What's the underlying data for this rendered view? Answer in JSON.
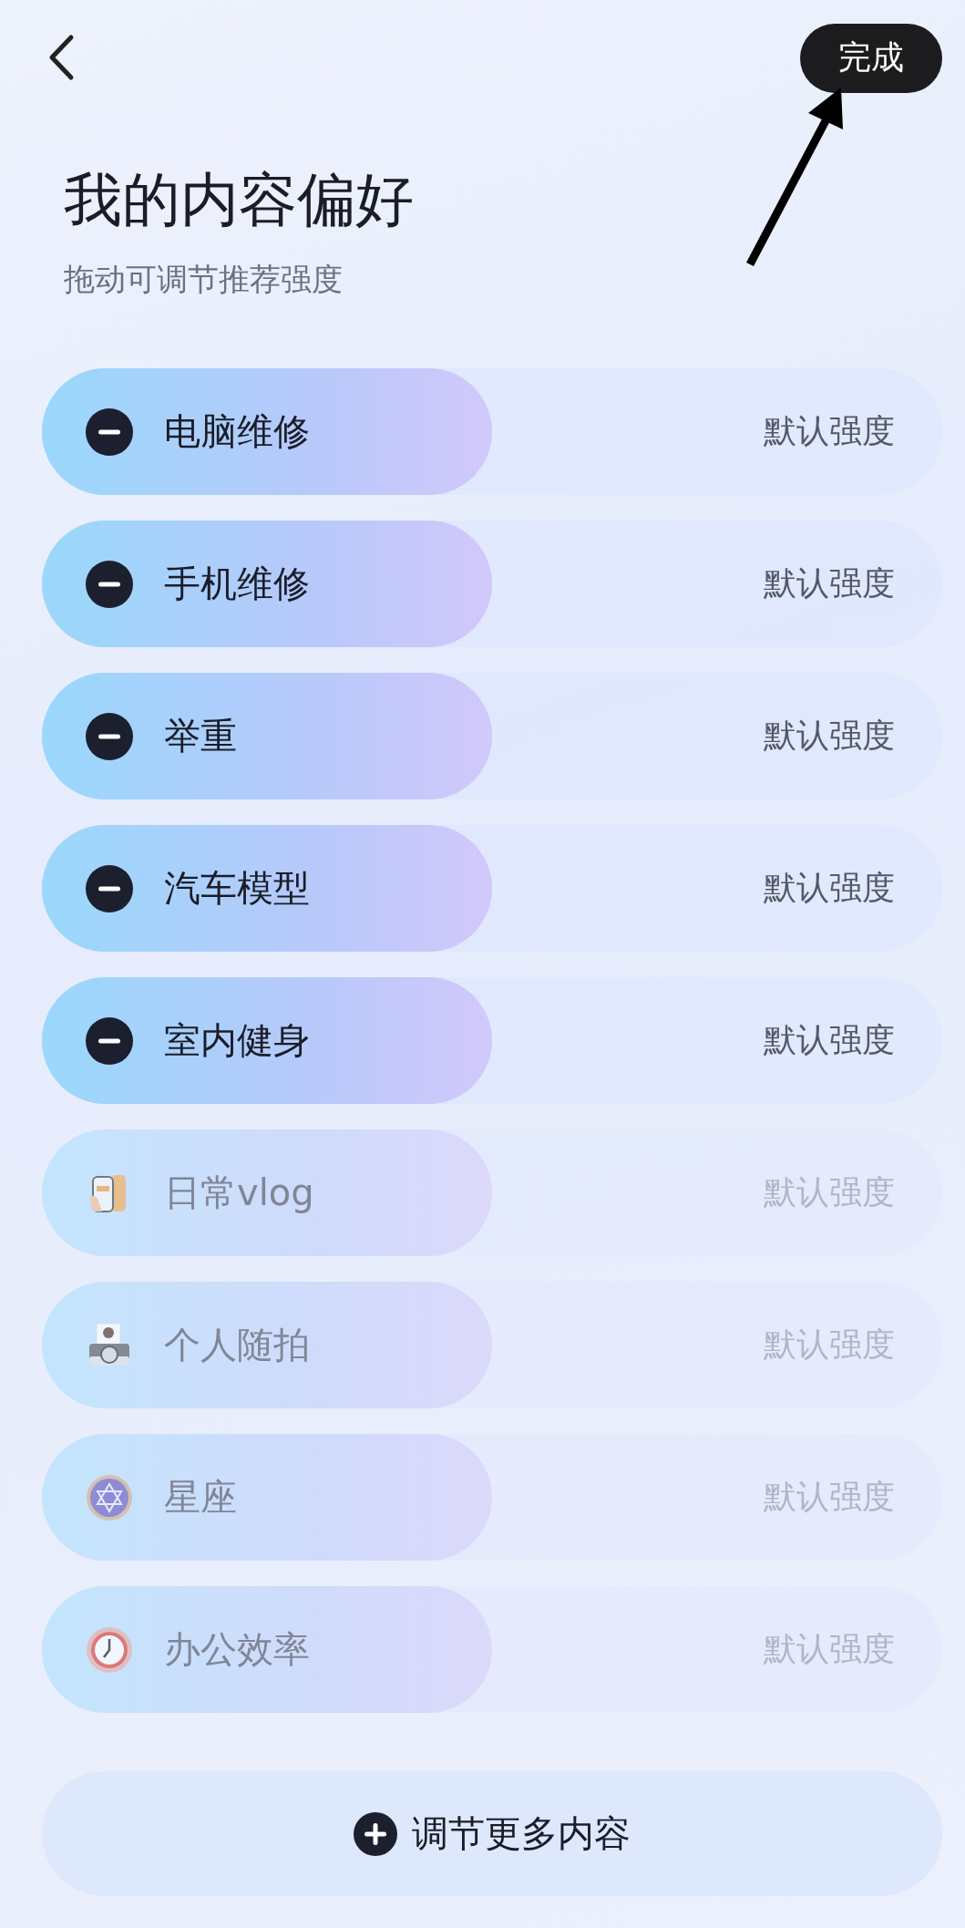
{
  "header": {
    "done_button": "完成"
  },
  "title": "我的内容偏好",
  "subtitle": "拖动可调节推荐强度",
  "rows": [
    {
      "label": "电脑维修",
      "added": true,
      "level": 0.5,
      "reading": "默认强度"
    },
    {
      "label": "手机维修",
      "added": true,
      "level": 0.5,
      "reading": "默认强度"
    },
    {
      "label": "举重",
      "added": true,
      "level": 0.5,
      "reading": "默认强度"
    },
    {
      "label": "汽车模型",
      "added": true,
      "level": 0.5,
      "reading": "默认强度"
    },
    {
      "label": "室内健身",
      "added": true,
      "level": 0.5,
      "reading": "默认强度"
    },
    {
      "label": "日常vlog",
      "added": false,
      "level": 0.5,
      "reading": "默认强度"
    },
    {
      "label": "个人随拍",
      "added": false,
      "level": 0.5,
      "reading": "默认强度"
    },
    {
      "label": "星座",
      "added": false,
      "level": 0.5,
      "reading": "默认强度"
    },
    {
      "label": "办公效率",
      "added": false,
      "level": 0.5,
      "reading": "默认强度"
    }
  ],
  "more_button": "调节更多内容"
}
